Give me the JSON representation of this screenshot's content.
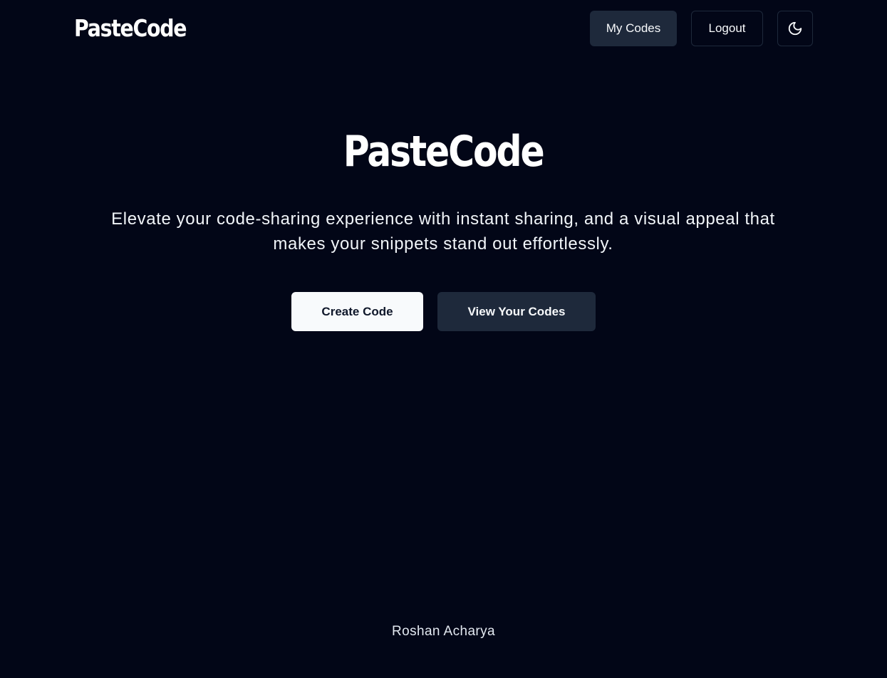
{
  "header": {
    "logo": "PasteCode",
    "my_codes_label": "My Codes",
    "logout_label": "Logout",
    "theme_toggle_icon": "moon-icon"
  },
  "hero": {
    "title": "PasteCode",
    "subtitle": "Elevate your code-sharing experience with instant sharing, and a visual appeal that makes your snippets stand out effortlessly.",
    "create_label": "Create Code",
    "view_label": "View Your Codes"
  },
  "footer": {
    "author": "Roshan Acharya"
  },
  "colors": {
    "background": "#020617",
    "secondary_button": "#1e293b",
    "primary_button": "#f8fafc",
    "text": "#f8fafc"
  }
}
